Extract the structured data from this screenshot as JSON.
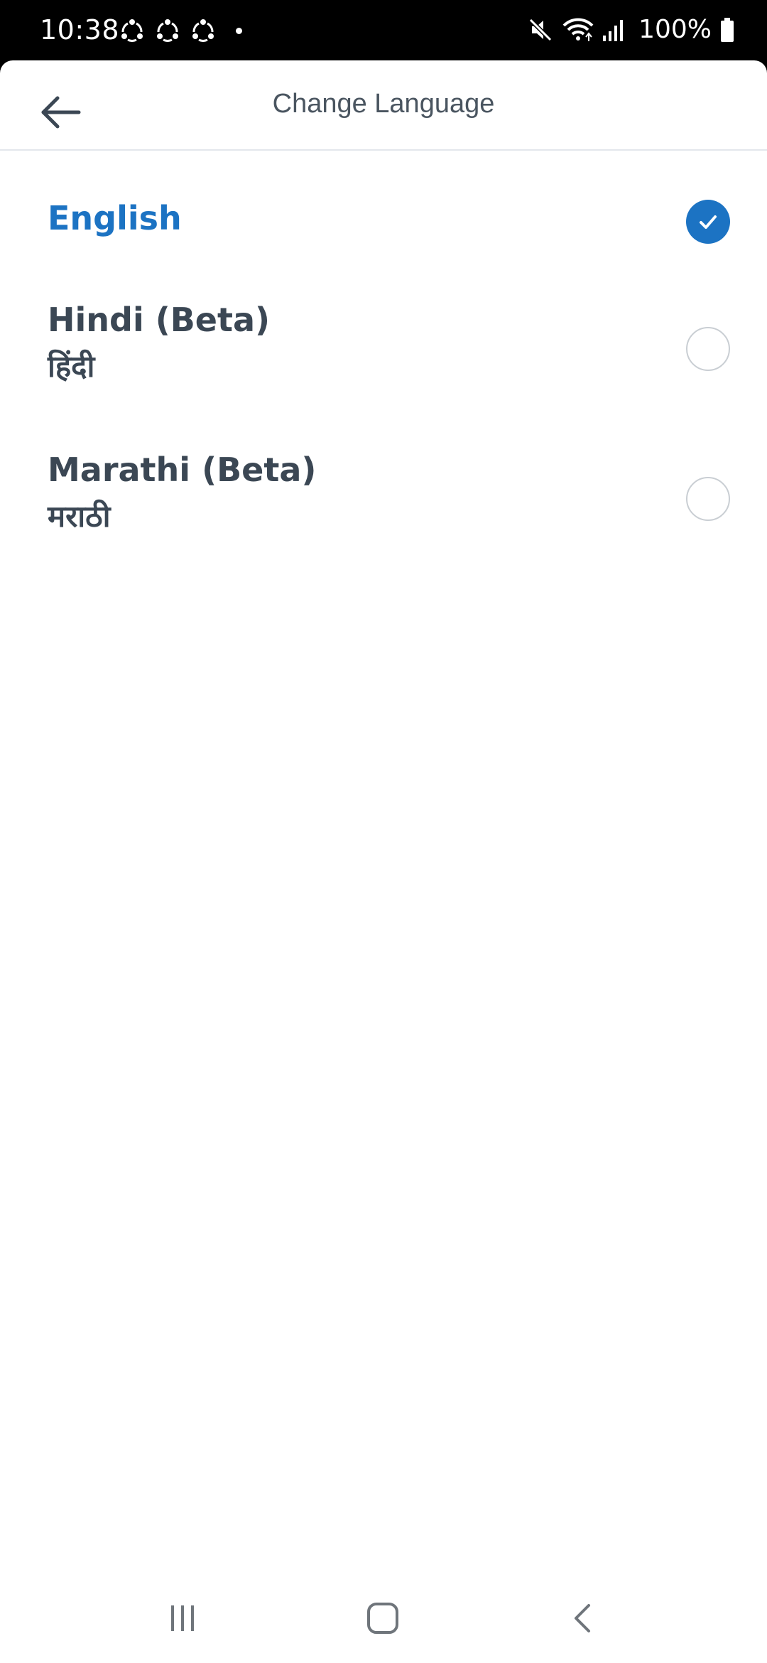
{
  "status_bar": {
    "time": "10:38",
    "battery": "100%",
    "notification_icons": [
      "sync-icon",
      "sync-icon",
      "sync-icon",
      "dot-icon"
    ],
    "system_icons": [
      "mute-icon",
      "wifi-icon",
      "signal-icon",
      "battery-icon"
    ]
  },
  "header": {
    "title": "Change Language",
    "back_icon": "arrow-left-icon"
  },
  "languages": [
    {
      "label": "English",
      "native": "",
      "selected": true
    },
    {
      "label": "Hindi (Beta)",
      "native": "हिंदी",
      "selected": false
    },
    {
      "label": "Marathi (Beta)",
      "native": "मराठी",
      "selected": false
    }
  ],
  "nav_bar": {
    "buttons": [
      "recents-icon",
      "home-icon",
      "back-icon"
    ]
  },
  "colors": {
    "accent": "#1c73c3",
    "text": "#3b4754",
    "title": "#4a5560",
    "divider": "#e3e7ec",
    "radio_border": "#c9ced3"
  }
}
